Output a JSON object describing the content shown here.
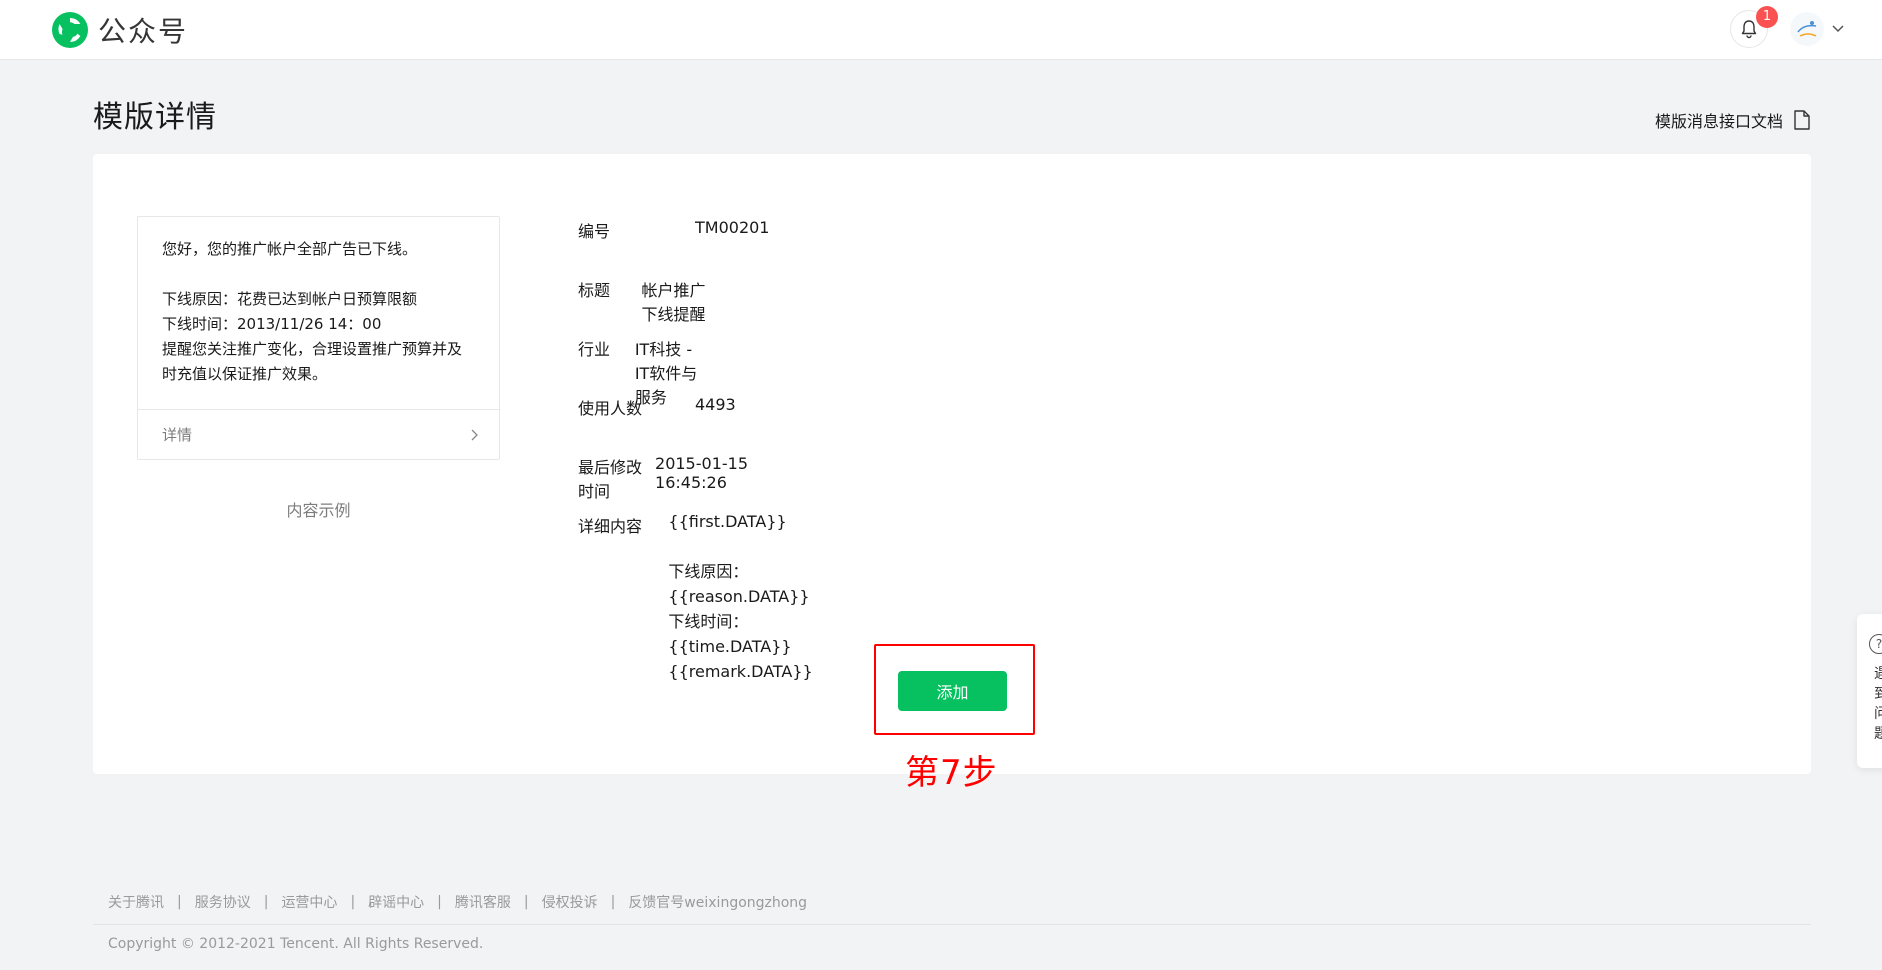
{
  "header": {
    "brand": "公众号",
    "notification_count": "1",
    "colors": {
      "brand_green": "#07c160",
      "badge_red": "#fa5151"
    }
  },
  "page": {
    "title": "模版详情",
    "doc_link": "模版消息接口文档"
  },
  "preview": {
    "lines": [
      "您好，您的推广帐户全部广告已下线。",
      "下线原因：花费已达到帐户日预算限额",
      "下线时间：2013/11/26 14：00",
      "提醒您关注推广变化，合理设置推广预算并及",
      "时充值以保证推广效果。"
    ],
    "detail_label": "详情",
    "caption": "内容示例"
  },
  "details": {
    "id_label": "编号",
    "id_value": "TM00201",
    "title_label": "标题",
    "title_value": "帐户推广下线提醒",
    "industry_label": "行业",
    "industry_value": "IT科技 - IT软件与服务",
    "users_label": "使用人数",
    "users_value": "4493",
    "modified_label": "最后修改时间",
    "modified_value": "2015-01-15 16:45:26",
    "content_label": "详细内容",
    "content_lines": [
      "{{first.DATA}}",
      "下线原因：{{reason.DATA}}",
      "下线时间：{{time.DATA}}",
      "{{remark.DATA}}"
    ]
  },
  "actions": {
    "add_label": "添加"
  },
  "annotation": {
    "text": "第7步",
    "color": "#ff0000"
  },
  "float_help": {
    "text": "遇到问题"
  },
  "footer": {
    "links": [
      "关于腾讯",
      "服务协议",
      "运营中心",
      "辟谣中心",
      "腾讯客服",
      "侵权投诉",
      "反馈官号weixingongzhong"
    ],
    "separator": "|",
    "copyright": "Copyright © 2012-2021 Tencent. All Rights Reserved."
  }
}
